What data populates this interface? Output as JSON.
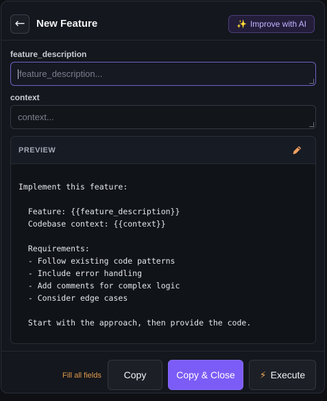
{
  "header": {
    "back_icon": "←",
    "title": "New Feature",
    "improve_icon": "✨",
    "improve_label": "Improve with AI"
  },
  "fields": [
    {
      "label": "feature_description",
      "placeholder": "feature_description..."
    },
    {
      "label": "context",
      "placeholder": "context..."
    }
  ],
  "preview": {
    "title": "PREVIEW",
    "edit_icon": "pencil-icon",
    "text": "Implement this feature:\n\n  Feature: {{feature_description}}\n  Codebase context: {{context}}\n\n  Requirements:\n  - Follow existing code patterns\n  - Include error handling\n  - Add comments for complex logic\n  - Consider edge cases\n\n  Start with the approach, then provide the code."
  },
  "footer": {
    "hint": "Fill all fields",
    "copy_label": "Copy",
    "copy_close_label": "Copy & Close",
    "execute_icon": "⚡",
    "execute_label": "Execute"
  },
  "colors": {
    "accent": "#7c5cf6",
    "warning": "#e09a4d",
    "background": "#14171d"
  }
}
